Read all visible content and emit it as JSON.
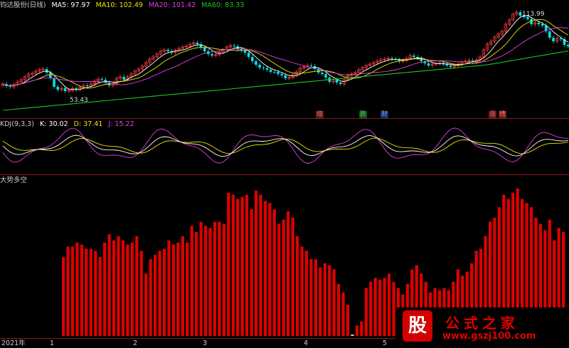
{
  "panel1": {
    "title": "钧达股份(日线)",
    "ma5": "MA5: 97.97",
    "ma10": "MA10: 102.49",
    "ma20": "MA20: 101.42",
    "ma60": "MA60: 83.33",
    "high_label": "113.99",
    "low_label": "53.43",
    "tags": [
      {
        "text": "增",
        "color": "#ff6060"
      },
      {
        "text": "跌",
        "color": "#3fd03f"
      },
      {
        "text": "财",
        "color": "#6aa0ff"
      },
      {
        "text": "涨",
        "color": "#ff6060"
      },
      {
        "text": "糟",
        "color": "#ff6060"
      }
    ]
  },
  "panel2": {
    "title": "KDJ(9,3,3)",
    "k": "K: 30.02",
    "d": "D: 37.41",
    "j": "J: 15.22"
  },
  "panel3": {
    "title": "大势多空"
  },
  "x_labels": [
    "2021年",
    "1",
    "2",
    "3",
    "4",
    "5"
  ],
  "watermark": {
    "logo": "股",
    "title": "公式之家",
    "url": "www.gszj100.com"
  },
  "colors": {
    "up": "#ff3c3c",
    "down": "#00e0e0",
    "ma5": "#ffffff",
    "ma10": "#e8e800",
    "ma20": "#e040e0",
    "ma60": "#20c020",
    "k": "#ffffff",
    "d": "#e8e800",
    "j": "#e040e0",
    "bar": "#e00000"
  },
  "chart_data": {
    "type": "bar",
    "series": [
      {
        "values": [
          38,
          43,
          43,
          45,
          44,
          42,
          42,
          41,
          38,
          45,
          49,
          46,
          48,
          46,
          44,
          45,
          48,
          41,
          30,
          37,
          39,
          41,
          42,
          46,
          44,
          45,
          48,
          45,
          53,
          50,
          55,
          53,
          52,
          55,
          55,
          54,
          69,
          68,
          66,
          67,
          68,
          61,
          70,
          68,
          65,
          64,
          61,
          54,
          56,
          60,
          57,
          48,
          43,
          41,
          37,
          37,
          33,
          35,
          34,
          32,
          25,
          21,
          15,
          0,
          5,
          7,
          23,
          26,
          28,
          27,
          28,
          30,
          26,
          23,
          20,
          25,
          32,
          34,
          30,
          26,
          21,
          23,
          22,
          23,
          22,
          26,
          32,
          29,
          31,
          35,
          41,
          42,
          48,
          55,
          57,
          62,
          68,
          66,
          69,
          71,
          66,
          64,
          62,
          57,
          54,
          51,
          56,
          46,
          52,
          50
        ]
      }
    ]
  }
}
